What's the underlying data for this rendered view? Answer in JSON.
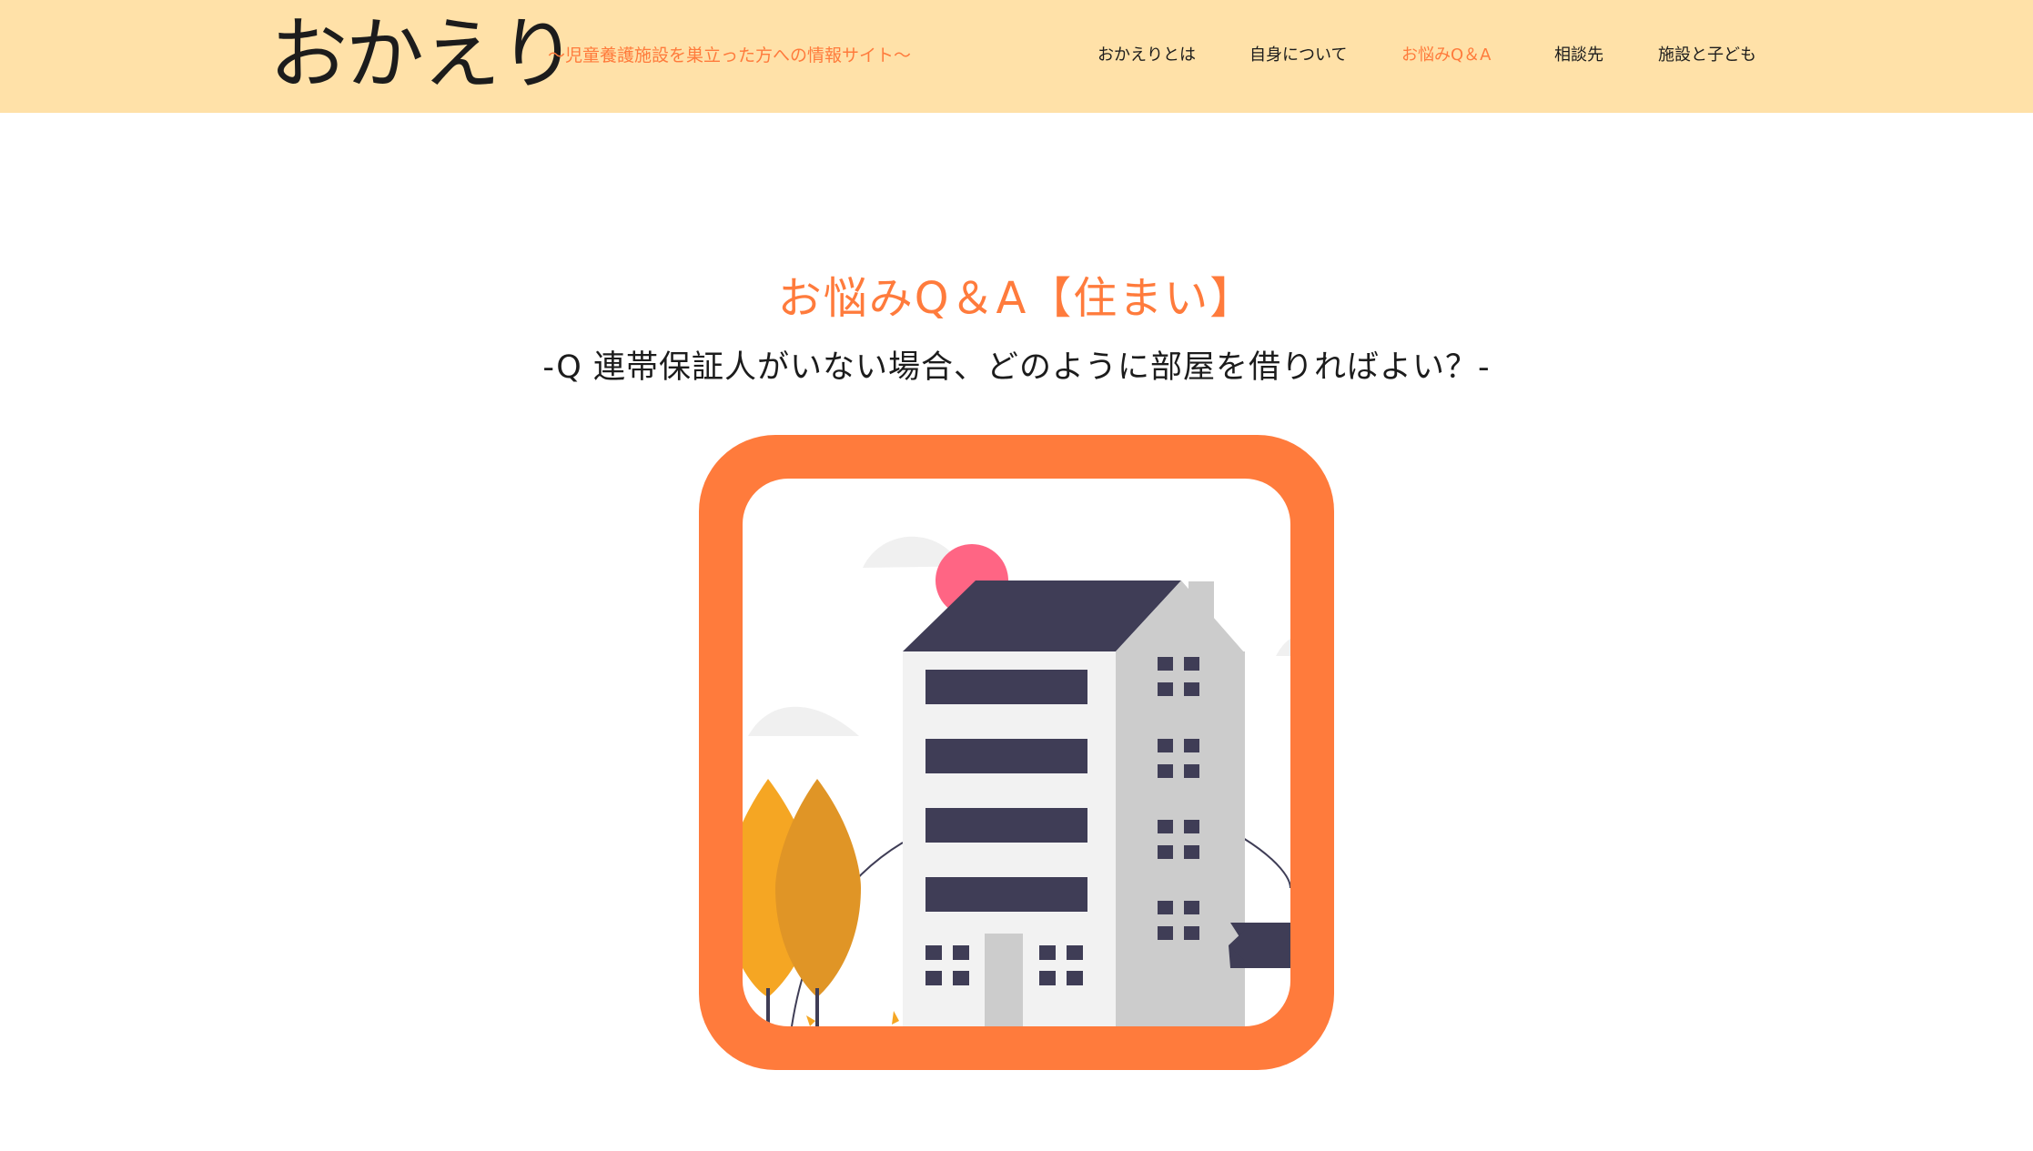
{
  "header": {
    "logo": "おかえり",
    "tagline": "〜児童養護施設を巣立った方への情報サイト〜",
    "nav": [
      {
        "label": "おかえりとは",
        "active": false
      },
      {
        "label": "自身について",
        "active": false
      },
      {
        "label": "お悩みQ＆A",
        "active": true
      },
      {
        "label": "相談先",
        "active": false
      },
      {
        "label": "施設と子ども",
        "active": false
      }
    ]
  },
  "main": {
    "title": "お悩みQ＆A【住まい】",
    "subtitle": "-Q 連帯保証人がいない場合、どのように部屋を借りればよい？-"
  },
  "colors": {
    "header_bg": "#ffe1a8",
    "accent": "#ff7b3c",
    "text": "#1c1c1c",
    "building_dark": "#3f3d56",
    "building_light": "#f2f2f2",
    "building_side": "#cccccc",
    "sun": "#ff6584",
    "tree_light": "#f5a623",
    "tree_dark": "#e09526"
  },
  "illustration": {
    "name": "apartment-building-illustration"
  }
}
